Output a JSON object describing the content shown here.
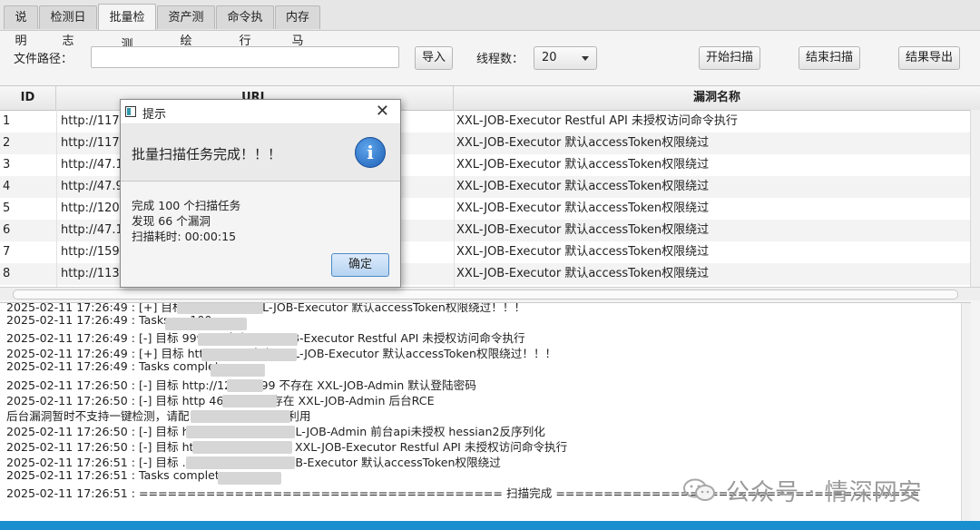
{
  "tabs": [
    "说明",
    "检测日志",
    "批量检测",
    "资产测绘",
    "命令执行",
    "内存马"
  ],
  "active_tab": "批量检测",
  "toolbar": {
    "path_label": "文件路径：",
    "path_value": "",
    "import_label": "导入",
    "threads_label": "线程数：",
    "threads_value": "20",
    "start_label": "开始扫描",
    "stop_label": "结束扫描",
    "export_label": "结果导出"
  },
  "table": {
    "columns": [
      "ID",
      "URL",
      "漏洞名称"
    ],
    "rows": [
      {
        "id": "1",
        "url": "http://117.",
        "vuln": "XXL-JOB-Executor Restful API 未授权访问命令执行"
      },
      {
        "id": "2",
        "url": "http://117.",
        "vuln": "XXL-JOB-Executor 默认accessToken权限绕过"
      },
      {
        "id": "3",
        "url": "http://47.1",
        "vuln": "XXL-JOB-Executor 默认accessToken权限绕过"
      },
      {
        "id": "4",
        "url": "http://47.9",
        "vuln": "XXL-JOB-Executor 默认accessToken权限绕过"
      },
      {
        "id": "5",
        "url": "http://120.",
        "vuln": "XXL-JOB-Executor 默认accessToken权限绕过"
      },
      {
        "id": "6",
        "url": "http://47.1",
        "vuln": "XXL-JOB-Executor 默认accessToken权限绕过"
      },
      {
        "id": "7",
        "url": "http://159.",
        "vuln": "XXL-JOB-Executor 默认accessToken权限绕过"
      },
      {
        "id": "8",
        "url": "http://113.",
        "vuln": "XXL-JOB-Executor 默认accessToken权限绕过"
      }
    ]
  },
  "log": [
    "2025-02-11 17:26:49 : [+] 目标                                0002 存在 XXL-JOB-Executor 默认accessToken权限绕过！！！",
    "2025-02-11 17:26:49 : Tasks co                      100",
    "2025-02-11 17:26:49 : [-] 目标                          9999 不存在 XXL-JOB-Executor Restful API 未授权访问命令执行",
    "2025-02-11 17:26:49 : [+] 目标 http:                    9999 存在 XXL-JOB-Executor 默认accessToken权限绕过！！！",
    "2025-02-11 17:26:49 : Tasks complet",
    "2025-02-11 17:26:50 : [-] 目标 http://12          6:9999 不存在 XXL-JOB-Admin 默认登陆密码",
    "2025-02-11 17:26:50 : [-] 目标 http              46:9999 不存在 XXL-JOB-Admin 后台RCE",
    "后台漏洞暂时不支持一键检测，请配               漏洞利用     块中进行利用",
    "2025-02-11 17:26:50 : [-] 目标 http              9999 不存在 XXL-JOB-Admin 前台api未授权 hessian2反序列化",
    "2025-02-11 17:26:50 : [-] 目标 http://          .9999 不存在 XXL-JOB-Executor Restful API 未授权访问命令执行",
    "2025-02-11 17:26:51 : [-] 目标              .9999 不存在 XXL-JOB-Executor 默认accessToken权限绕过",
    "2025-02-11 17:26:51 : Tasks complete",
    "2025-02-11 17:26:51 : ====================================== 扫描完成 ======================================"
  ],
  "dialog": {
    "title": "提示",
    "header": "批量扫描任务完成！！！",
    "line1": "完成 100 个扫描任务",
    "line2": "发现 66 个漏洞",
    "line3": "扫描耗时: 00:00:15",
    "ok_label": "确定"
  },
  "watermark": "公众号 · 情深网安",
  "colors": {
    "accent": "#1a8fd0",
    "info_icon": "#2a6fc4"
  }
}
